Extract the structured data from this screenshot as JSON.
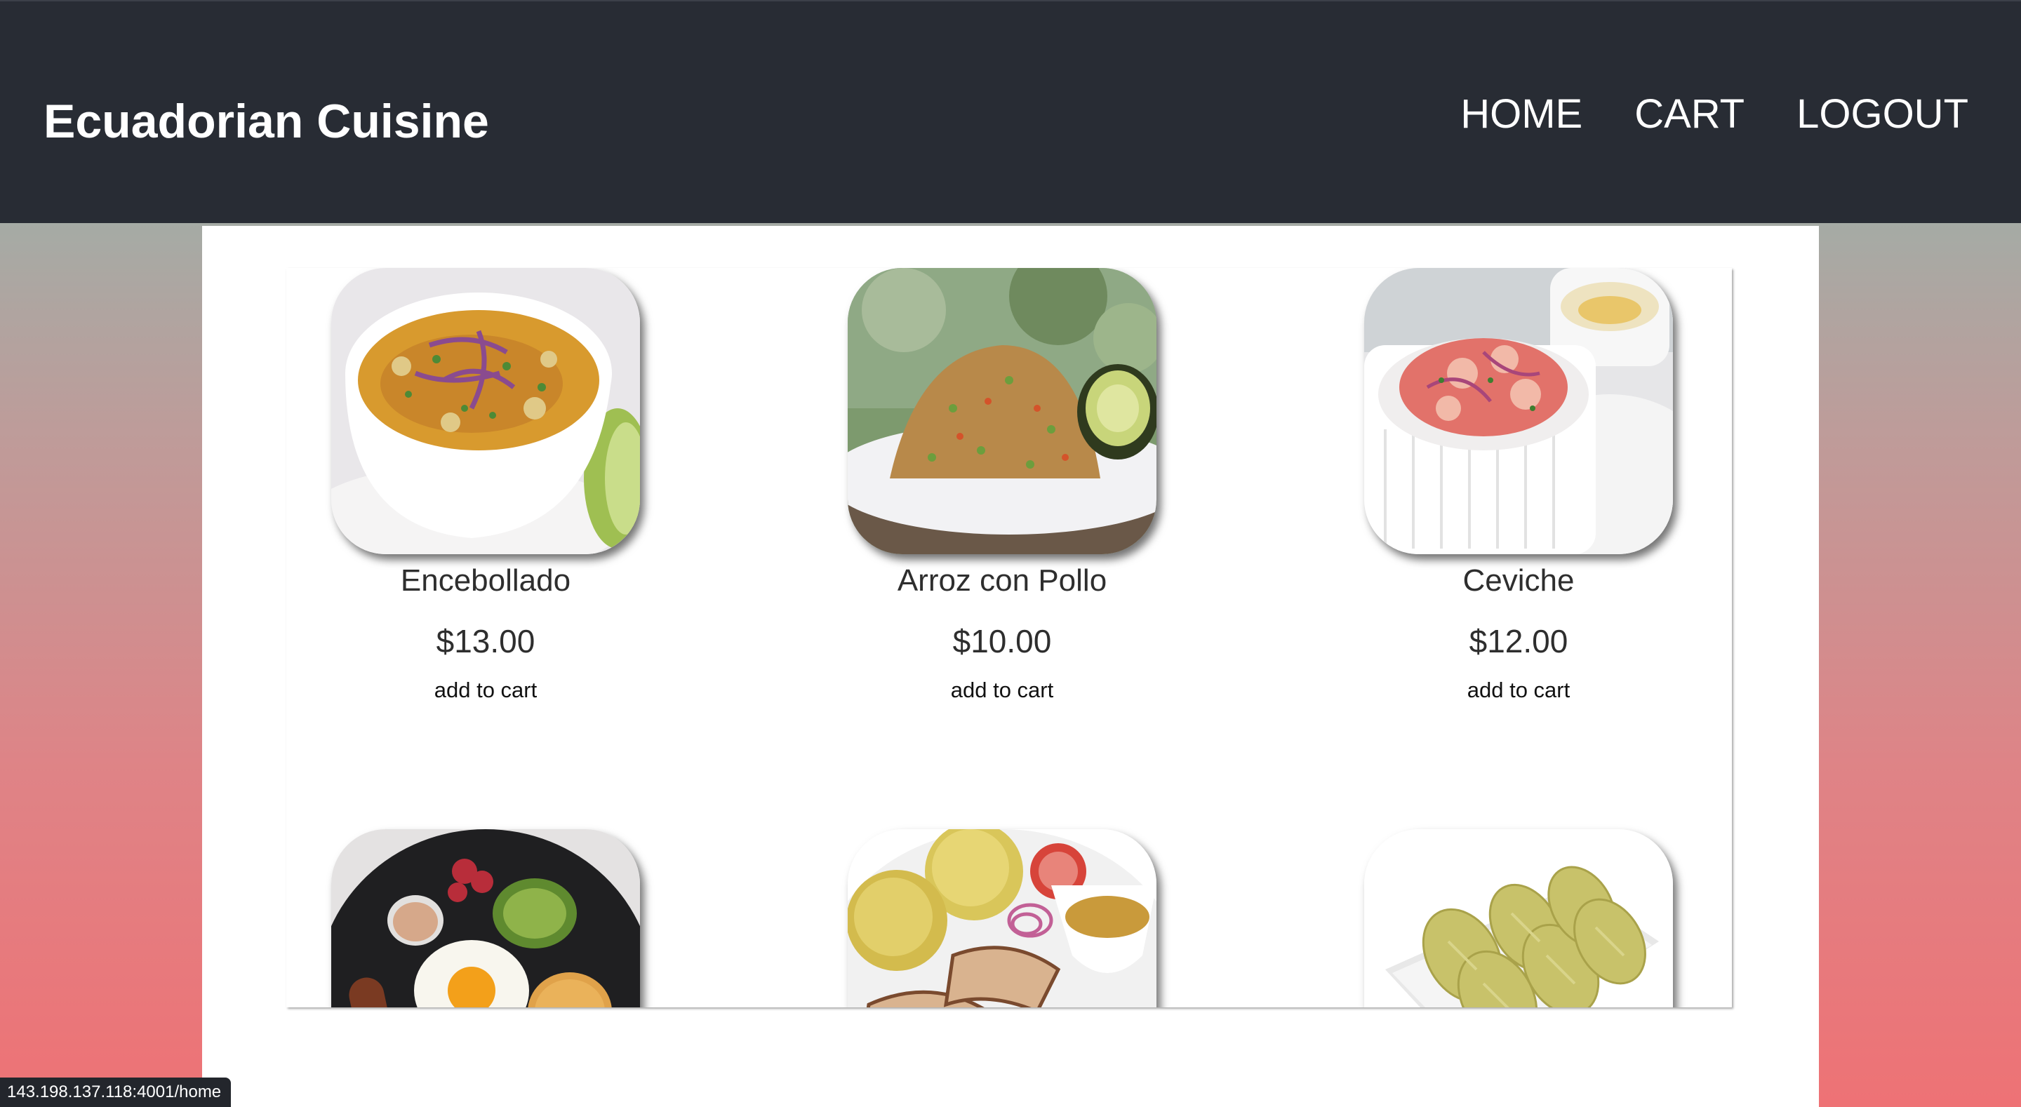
{
  "brand": "Ecuadorian Cuisine",
  "nav": [
    {
      "label": "HOME"
    },
    {
      "label": "CART"
    },
    {
      "label": "LOGOUT"
    }
  ],
  "products": [
    {
      "name": "Encebollado",
      "price": "$13.00",
      "action": "add to cart",
      "icon": "encebollado-soup-photo"
    },
    {
      "name": "Arroz con Pollo",
      "price": "$10.00",
      "action": "add to cart",
      "icon": "arroz-con-pollo-photo"
    },
    {
      "name": "Ceviche",
      "price": "$12.00",
      "action": "add to cart",
      "icon": "ceviche-photo"
    },
    {
      "icon": "breakfast-plate-photo"
    },
    {
      "icon": "roast-chicken-plate-photo"
    },
    {
      "icon": "humitas-photo"
    }
  ],
  "status_url": "143.198.137.118:4001/home",
  "colors": {
    "header_bg": "#282c34",
    "gradient_top": "#8bbbb1",
    "gradient_bottom": "#ee7275"
  }
}
